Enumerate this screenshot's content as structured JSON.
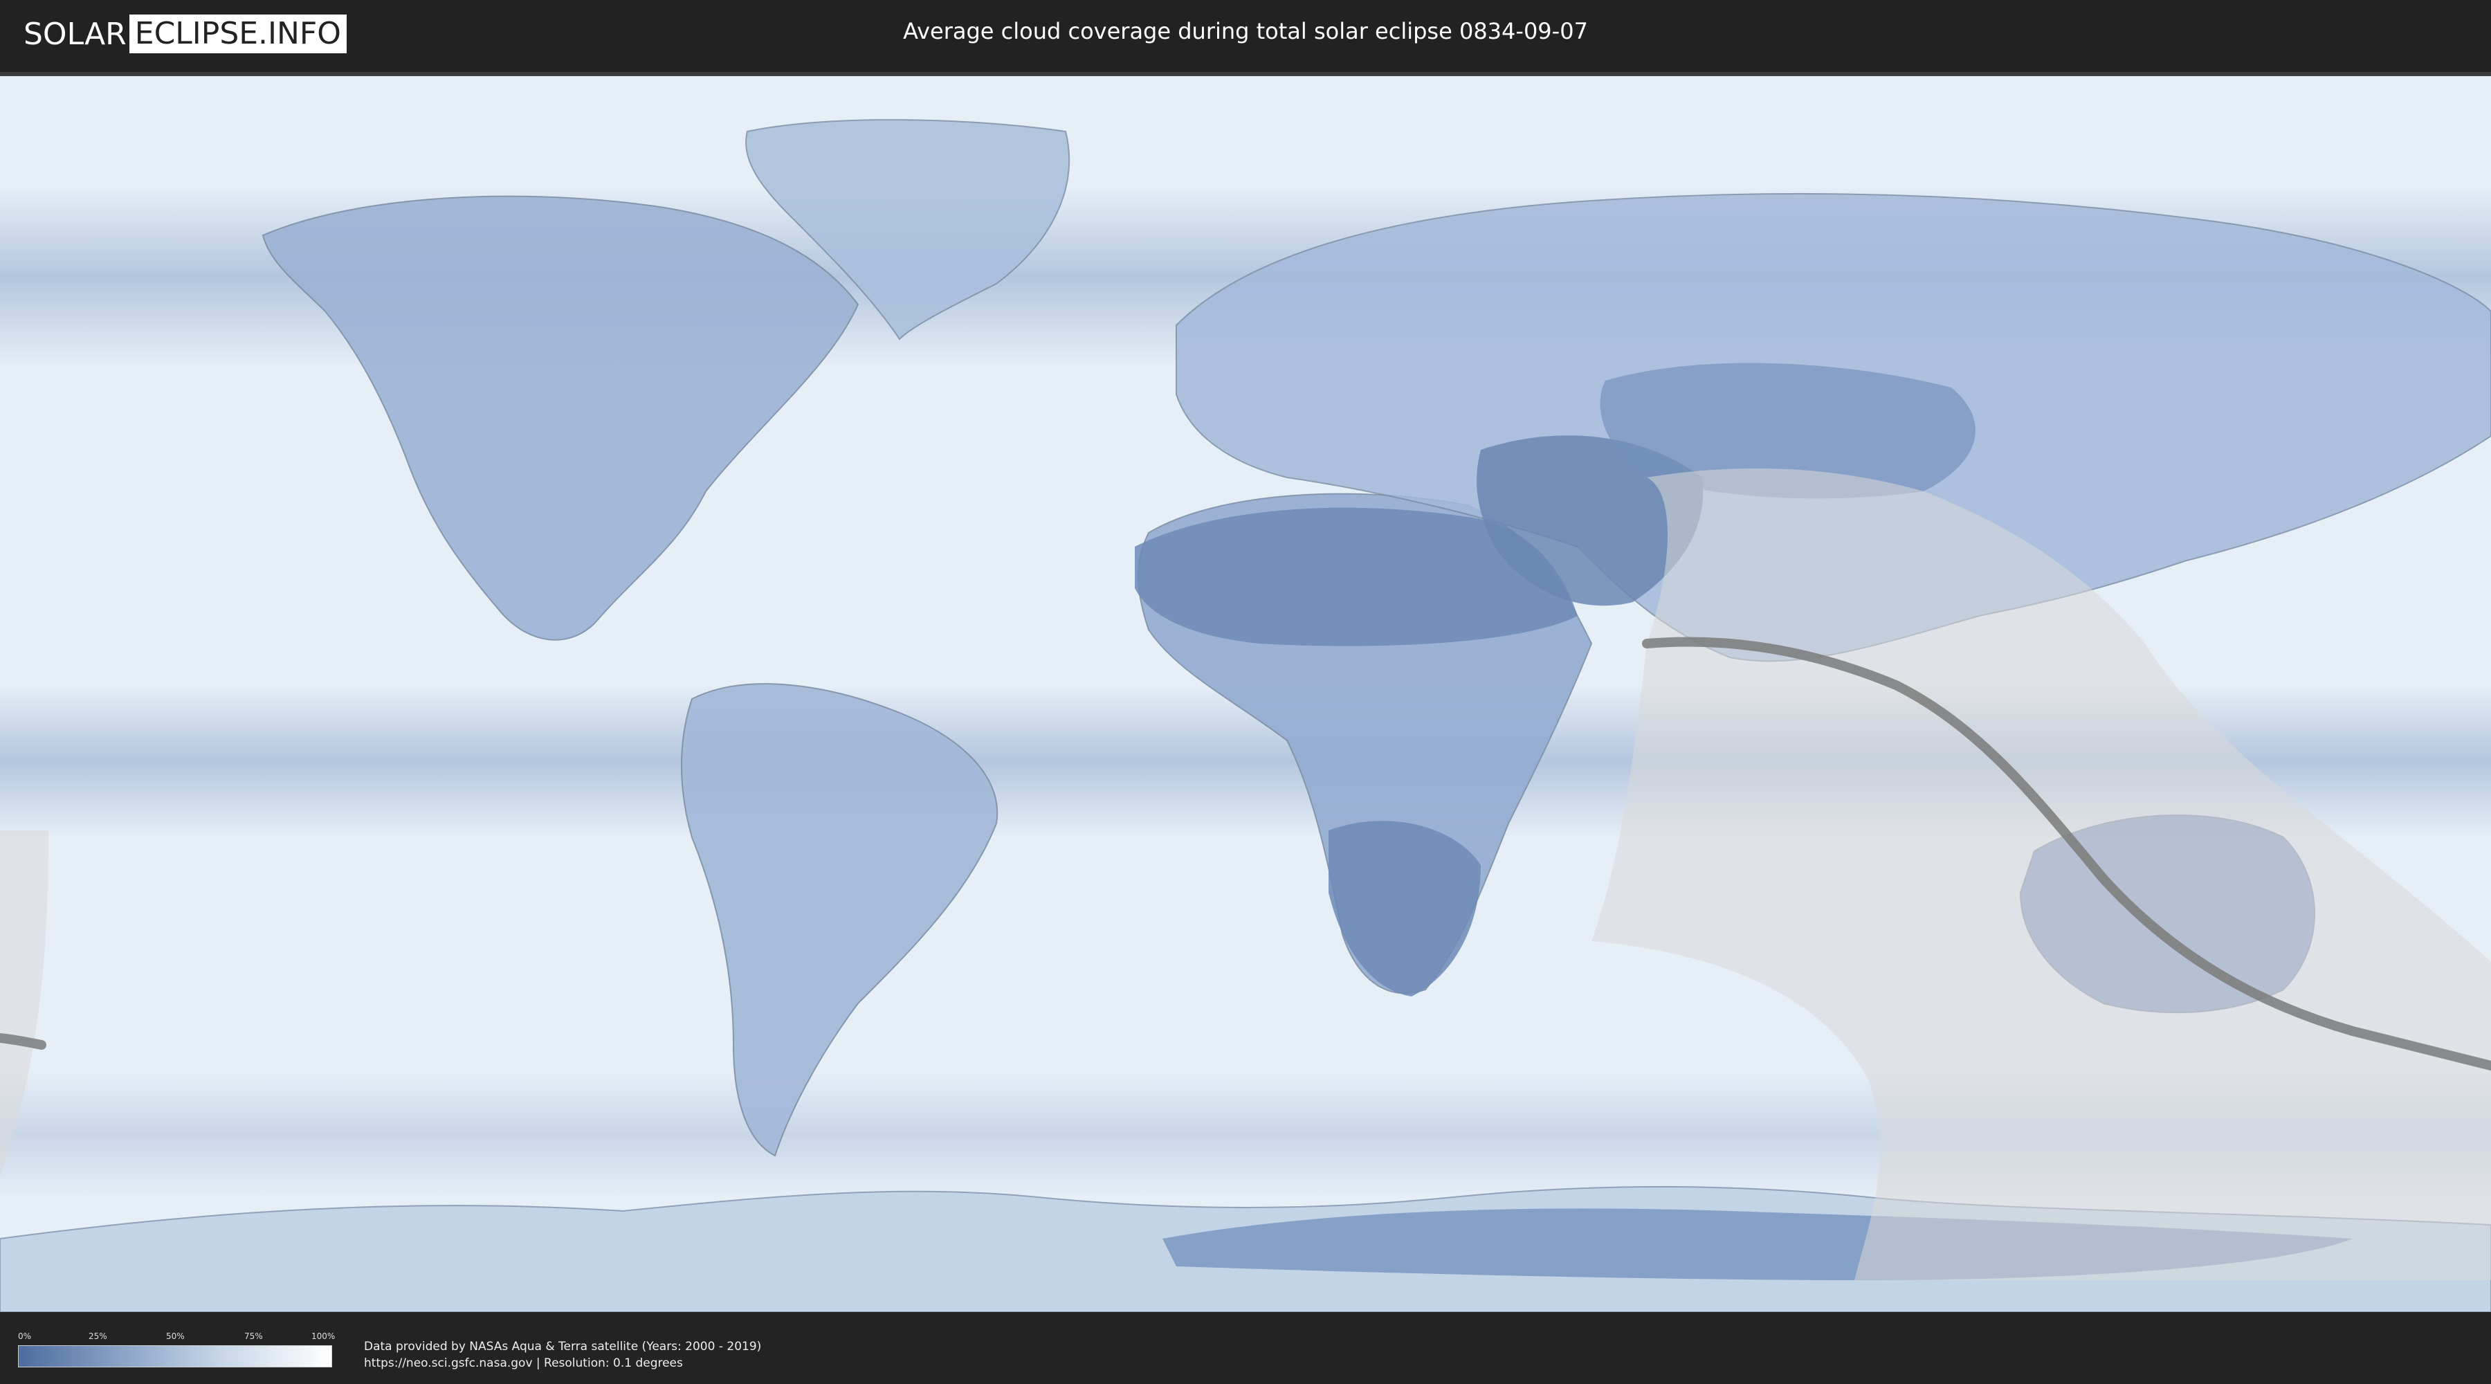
{
  "header": {
    "logo_left": "SOLAR",
    "logo_right": "ECLIPSE.INFO",
    "title": "Average cloud coverage during total solar eclipse 0834-09-07"
  },
  "legend": {
    "ticks": [
      "0%",
      "25%",
      "50%",
      "75%",
      "100%"
    ],
    "colors": {
      "low": "#4d6c9f",
      "high": "#ffffff"
    }
  },
  "footer": {
    "credit_line1": "Data provided by NASAs Aqua & Terra satellite (Years: 2000 - 2019)",
    "credit_line2": "https://neo.sci.gsfc.nasa.gov | Resolution: 0.1 degrees"
  },
  "map": {
    "ocean_color": "#e9f0f7",
    "cloud_low_color": "#6f8fbf",
    "eclipse_overlay_color": "#d9d9d9",
    "central_line_color": "#7a7a7a"
  }
}
